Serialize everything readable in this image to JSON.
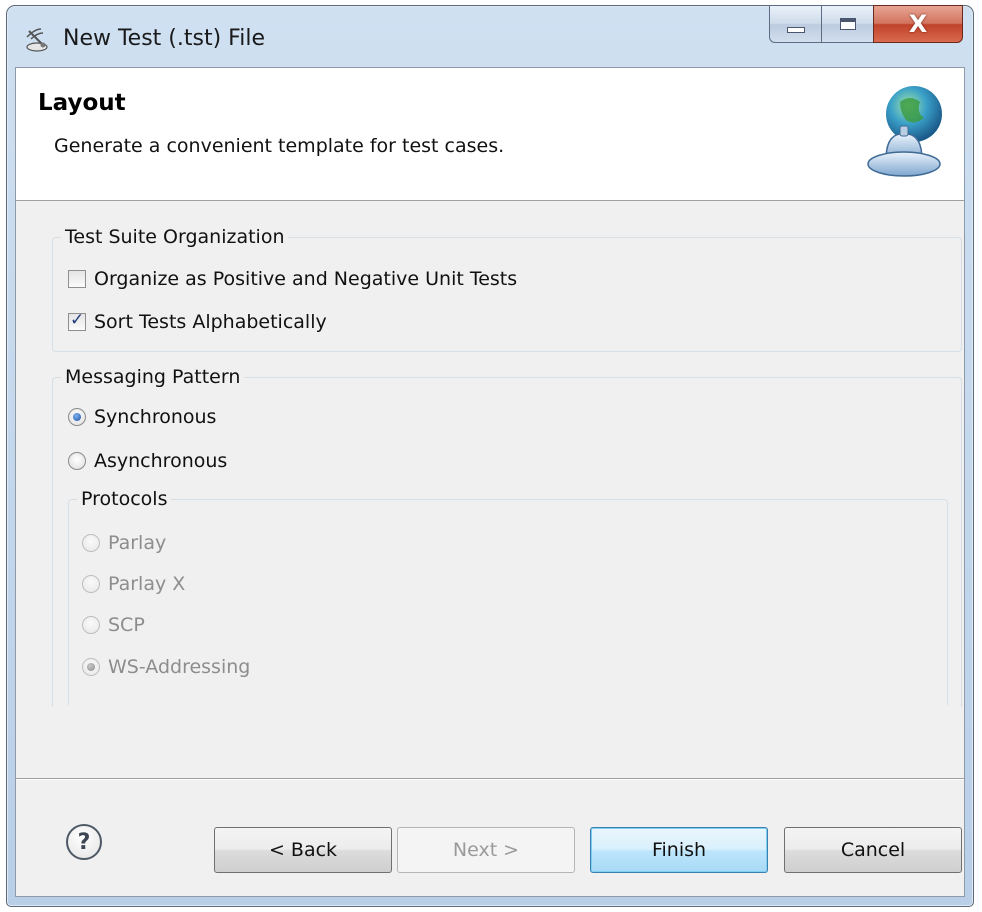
{
  "window": {
    "title": "New Test (.tst) File",
    "close_glyph": "X",
    "icons": {
      "app": "wizard-satellite-icon",
      "minimize": "minimize-icon",
      "maximize": "maximize-icon",
      "close": "close-icon"
    }
  },
  "banner": {
    "title": "Layout",
    "description": "Generate a convenient template for test cases.",
    "icon": "globe-bell-icon"
  },
  "test_suite_organization": {
    "legend": "Test Suite Organization",
    "options": [
      {
        "label": "Organize as Positive and Negative Unit Tests",
        "checked": false
      },
      {
        "label": "Sort Tests Alphabetically",
        "checked": true
      }
    ]
  },
  "messaging_pattern": {
    "legend": "Messaging Pattern",
    "options": [
      {
        "label": "Synchronous",
        "selected": true
      },
      {
        "label": "Asynchronous",
        "selected": false
      }
    ],
    "protocols": {
      "legend": "Protocols",
      "enabled": false,
      "options": [
        {
          "label": "Parlay",
          "selected": false
        },
        {
          "label": "Parlay X",
          "selected": false
        },
        {
          "label": "SCP",
          "selected": false
        },
        {
          "label": "WS-Addressing",
          "selected": true
        }
      ]
    }
  },
  "footer": {
    "help_label": "?",
    "help_icon": "help-icon",
    "back_label": "< Back",
    "next_label": "Next >",
    "finish_label": "Finish",
    "cancel_label": "Cancel"
  },
  "colors": {
    "titlebar": "#c4d7ee",
    "close_button": "#c8513a",
    "dialog_background": "#f0f0f0",
    "default_button_border": "#3c7fb1"
  }
}
